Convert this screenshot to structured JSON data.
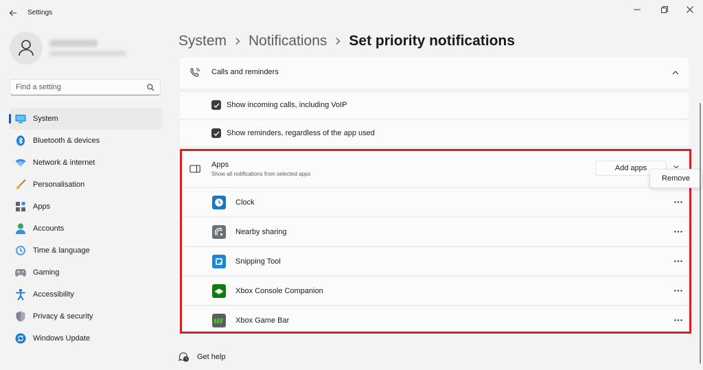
{
  "window": {
    "title": "Settings",
    "controls": [
      "minimize",
      "restore",
      "close"
    ]
  },
  "search": {
    "placeholder": "Find a setting"
  },
  "sidebar": {
    "items": [
      {
        "label": "System",
        "icon": "monitor-icon",
        "active": true
      },
      {
        "label": "Bluetooth & devices",
        "icon": "bluetooth-icon",
        "active": false
      },
      {
        "label": "Network & internet",
        "icon": "wifi-icon",
        "active": false
      },
      {
        "label": "Personalisation",
        "icon": "brush-icon",
        "active": false
      },
      {
        "label": "Apps",
        "icon": "apps-icon",
        "active": false
      },
      {
        "label": "Accounts",
        "icon": "person-icon",
        "active": false
      },
      {
        "label": "Time & language",
        "icon": "clock-globe-icon",
        "active": false
      },
      {
        "label": "Gaming",
        "icon": "gamepad-icon",
        "active": false
      },
      {
        "label": "Accessibility",
        "icon": "accessibility-icon",
        "active": false
      },
      {
        "label": "Privacy & security",
        "icon": "shield-icon",
        "active": false
      },
      {
        "label": "Windows Update",
        "icon": "windows-update-icon",
        "active": false
      }
    ]
  },
  "breadcrumb": {
    "items": [
      "System",
      "Notifications",
      "Set priority notifications"
    ]
  },
  "calls": {
    "title": "Calls and reminders",
    "options": [
      {
        "label": "Show incoming calls, including VoIP",
        "checked": true
      },
      {
        "label": "Show reminders, regardless of the app used",
        "checked": true
      }
    ]
  },
  "apps_section": {
    "title": "Apps",
    "subtitle": "Show all notifications from selected apps",
    "add_label": "Add apps",
    "apps": [
      {
        "name": "Clock",
        "icon": "clock-app-icon",
        "color": "#1a78c2"
      },
      {
        "name": "Nearby sharing",
        "icon": "nearby-sharing-icon",
        "color": "#6b7076"
      },
      {
        "name": "Snipping Tool",
        "icon": "snipping-tool-icon",
        "color": "#1f86d3"
      },
      {
        "name": "Xbox Console Companion",
        "icon": "xbox-icon",
        "color": "#107c10"
      },
      {
        "name": "Xbox Game Bar",
        "icon": "xbox-game-bar-icon",
        "color": "#5a5f63"
      }
    ]
  },
  "context_menu": {
    "remove_label": "Remove"
  },
  "footer": {
    "help_label": "Get help"
  },
  "colors": {
    "accent": "#005fb8",
    "highlight": "#d71f26",
    "background": "#f3f3f3",
    "card": "#fbfbfb"
  }
}
